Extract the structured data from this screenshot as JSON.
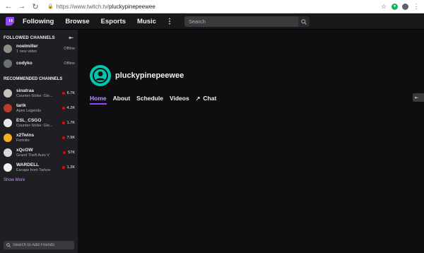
{
  "browser": {
    "url_host": "https://www.twitch.tv/",
    "url_path": "pluckypinepeewee"
  },
  "topnav": {
    "items": [
      "Following",
      "Browse",
      "Esports",
      "Music"
    ],
    "search_placeholder": "Search"
  },
  "sidebar": {
    "followed_title": "FOLLOWED CHANNELS",
    "followed": [
      {
        "name": "noelmiller",
        "sub": "1 new video",
        "status": "Offline",
        "color": "#8a8f86"
      },
      {
        "name": "codyko",
        "sub": "",
        "status": "Offline",
        "color": "#6b6f77"
      }
    ],
    "recommended_title": "RECOMMENDED CHANNELS",
    "recommended": [
      {
        "name": "sinatraa",
        "sub": "Counter-Strike: Glo...",
        "count": "6.7K",
        "color": "#c9c2b8"
      },
      {
        "name": "tarik",
        "sub": "Apex Legends",
        "count": "4.2K",
        "color": "#d8d2cc"
      },
      {
        "name": "ESL_CSGO",
        "sub": "Counter-Strike: Glo...",
        "count": "1.7K",
        "color": "#e8e8e8"
      },
      {
        "name": "x2Twins",
        "sub": "Fortnite",
        "count": "7.9K",
        "color": "#f2b01e"
      },
      {
        "name": "xQcOW",
        "sub": "Grand Theft Auto V",
        "count": "57K",
        "color": "#d9d9d9"
      },
      {
        "name": "WARDELL",
        "sub": "Escape from Tarkov",
        "count": "1.2K",
        "color": "#f0f0f0"
      }
    ],
    "show_more": "Show More",
    "friends_placeholder": "Search to Add Friends"
  },
  "profile": {
    "name": "pluckypinepeewee",
    "avatar_color": "#00c8af"
  },
  "tabs": [
    "Home",
    "About",
    "Schedule",
    "Videos",
    "Chat"
  ],
  "colors": {
    "accent": "#9147ff",
    "accent_text": "#bf94ff",
    "live": "#eb0400"
  }
}
